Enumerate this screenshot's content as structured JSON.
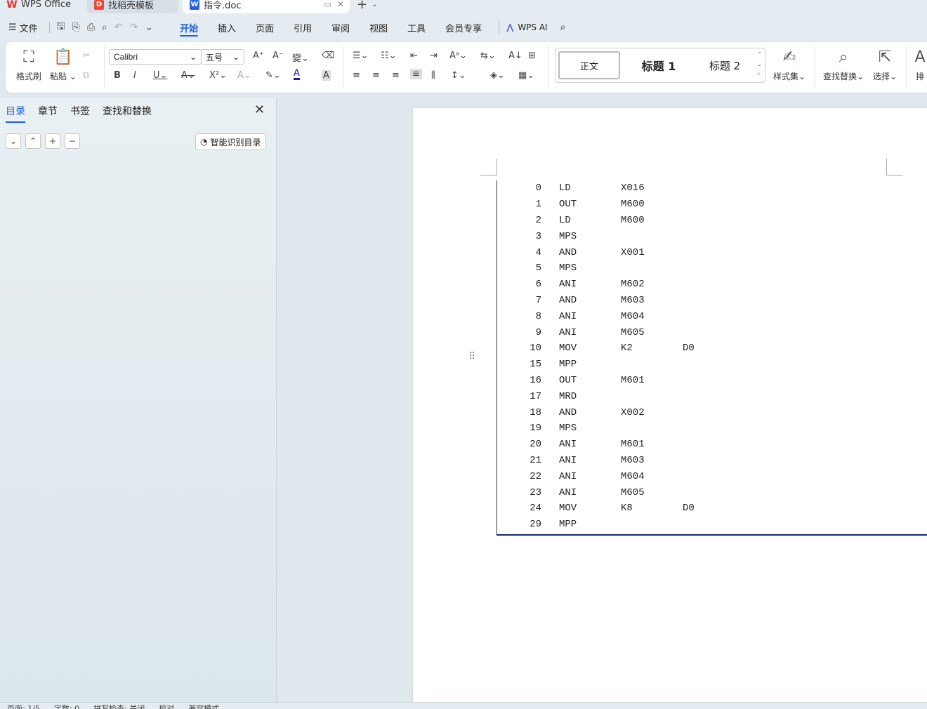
{
  "tabs": [
    {
      "label": "WPS Office",
      "icon": "wps-logo-icon"
    },
    {
      "label": "找稻壳模板",
      "icon": "docer-icon"
    },
    {
      "label": "指令.doc",
      "icon": "word-doc-icon"
    }
  ],
  "menu": {
    "file": "文件",
    "tabs": [
      "开始",
      "插入",
      "页面",
      "引用",
      "审阅",
      "视图",
      "工具",
      "会员专享"
    ],
    "active_tab": "开始",
    "ai": "WPS AI"
  },
  "ribbon": {
    "format_painter": "格式刷",
    "paste": "粘贴",
    "font_name": "Calibri",
    "font_size": "五号",
    "styles": {
      "normal": "正文",
      "h1": "标题 1",
      "h2": "标题 2"
    },
    "style_set": "样式集",
    "find_replace": "查找替换",
    "select": "选择",
    "layout_partial": "排"
  },
  "nav_panel": {
    "tabs": [
      "目录",
      "章节",
      "书签",
      "查找和替换"
    ],
    "active_tab": "目录",
    "smart_toc": "智能识别目录"
  },
  "document": {
    "rows": [
      {
        "n": "0",
        "op": "LD",
        "a": "X016",
        "b": ""
      },
      {
        "n": "1",
        "op": "OUT",
        "a": "M600",
        "b": ""
      },
      {
        "n": "2",
        "op": "LD",
        "a": "M600",
        "b": ""
      },
      {
        "n": "3",
        "op": "MPS",
        "a": "",
        "b": ""
      },
      {
        "n": "4",
        "op": "AND",
        "a": "X001",
        "b": ""
      },
      {
        "n": "5",
        "op": "MPS",
        "a": "",
        "b": ""
      },
      {
        "n": "6",
        "op": "ANI",
        "a": "M602",
        "b": ""
      },
      {
        "n": "7",
        "op": "AND",
        "a": "M603",
        "b": ""
      },
      {
        "n": "8",
        "op": "ANI",
        "a": "M604",
        "b": ""
      },
      {
        "n": "9",
        "op": "ANI",
        "a": "M605",
        "b": ""
      },
      {
        "n": "10",
        "op": "MOV",
        "a": "K2",
        "b": "D0"
      },
      {
        "n": "15",
        "op": "MPP",
        "a": "",
        "b": ""
      },
      {
        "n": "16",
        "op": "OUT",
        "a": "M601",
        "b": ""
      },
      {
        "n": "17",
        "op": "MRD",
        "a": "",
        "b": ""
      },
      {
        "n": "18",
        "op": "AND",
        "a": "X002",
        "b": ""
      },
      {
        "n": "19",
        "op": "MPS",
        "a": "",
        "b": ""
      },
      {
        "n": "20",
        "op": "ANI",
        "a": "M601",
        "b": ""
      },
      {
        "n": "21",
        "op": "ANI",
        "a": "M603",
        "b": ""
      },
      {
        "n": "22",
        "op": "ANI",
        "a": "M604",
        "b": ""
      },
      {
        "n": "23",
        "op": "ANI",
        "a": "M605",
        "b": ""
      },
      {
        "n": "24",
        "op": "MOV",
        "a": "K8",
        "b": "D0"
      },
      {
        "n": "29",
        "op": "MPP",
        "a": "",
        "b": ""
      }
    ]
  },
  "status": {
    "page": "页面: 1/5",
    "words": "字数: 0",
    "spell": "拼写检查: 关闭",
    "proof": "校对",
    "compat": "兼容模式"
  },
  "colors": {
    "accent": "#1f5fd4",
    "underline": "#1a237e"
  }
}
